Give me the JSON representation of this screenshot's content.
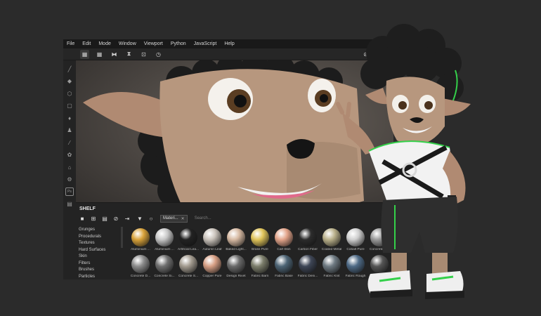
{
  "menu": [
    "File",
    "Edit",
    "Mode",
    "Window",
    "Viewport",
    "Python",
    "JavaScript",
    "Help"
  ],
  "shelf": {
    "title": "SHELF",
    "filter_chip": "Materi...",
    "search_placeholder": "Search...",
    "categories": [
      "Grunges",
      "Procedurals",
      "Textures",
      "Hard Surfaces",
      "Skin",
      "Filters",
      "Brushes",
      "Particles"
    ],
    "materials": [
      {
        "label": "Aluminium ...",
        "color": "#d8a23a"
      },
      {
        "label": "Aluminium ...",
        "color": "#c7c7c7"
      },
      {
        "label": "Artificial Lea...",
        "color": "#222"
      },
      {
        "label": "Autumn Leaf",
        "color": "#c9c2ba"
      },
      {
        "label": "Baked Light...",
        "color": "#d6b9a2"
      },
      {
        "label": "Brass Pure",
        "color": "#e0c45a"
      },
      {
        "label": "Calf Skin",
        "color": "#e3a48a"
      },
      {
        "label": "Carbon Fiber",
        "color": "#2c2c2c"
      },
      {
        "label": "Coated Metal",
        "color": "#b9b08a"
      },
      {
        "label": "Cobalt Pure",
        "color": "#cfcfcf"
      },
      {
        "label": "Concrete B...",
        "color": "#9a9a9a"
      },
      {
        "label": "Concrete D...",
        "color": "#8c8c8c"
      },
      {
        "label": "Concrete Si...",
        "color": "#6f6f6f"
      },
      {
        "label": "Concrete S...",
        "color": "#a39b8f"
      },
      {
        "label": "Copper Pure",
        "color": "#d79f84"
      },
      {
        "label": "Design Rivet",
        "color": "#6a6a6a"
      },
      {
        "label": "Fabric Barn",
        "color": "#7c7e6b"
      },
      {
        "label": "Fabric Base",
        "color": "#4d6475"
      },
      {
        "label": "Fabric Deni...",
        "color": "#3e4656"
      },
      {
        "label": "Fabric Knit",
        "color": "#6e7a82"
      },
      {
        "label": "Fabric Rough",
        "color": "#4e6a86"
      },
      {
        "label": "",
        "color": "#555"
      }
    ]
  },
  "colors": {
    "accent_green": "#34d04a",
    "app_bg": "#1f1f1f",
    "page_bg": "#2b2b2b"
  }
}
